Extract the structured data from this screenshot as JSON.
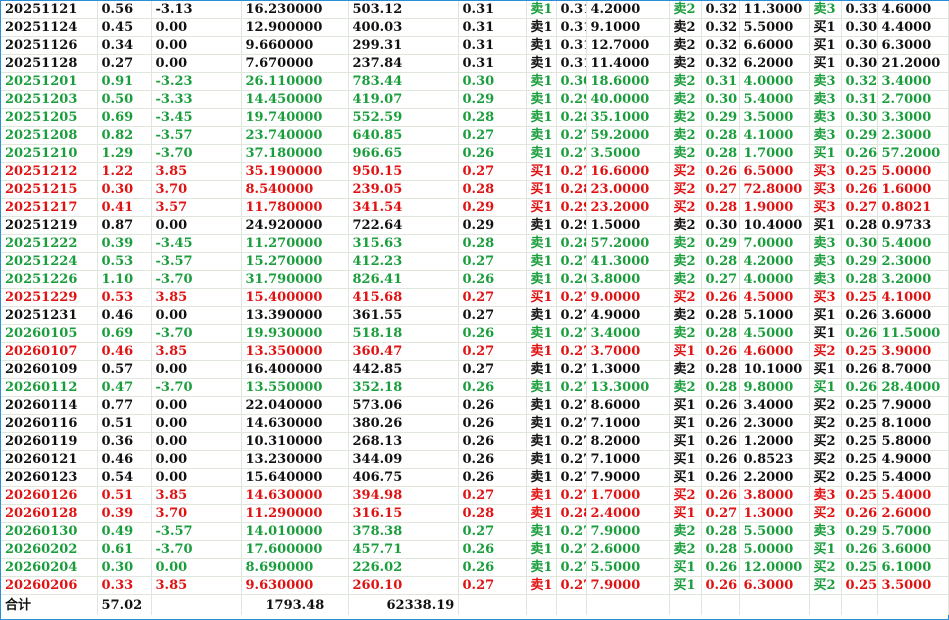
{
  "colors": {
    "black": "#111111",
    "green": "#1a9e3c",
    "red": "#e01212"
  },
  "rows": [
    [
      "20251121",
      "0.56",
      "-3.13",
      "16.230000",
      "503.12",
      "0.31",
      "卖1",
      "0.31",
      "4.2000",
      "卖2",
      "0.32",
      "11.3000",
      "卖3",
      "0.33",
      "4.6000"
    ],
    [
      "20251124",
      "0.45",
      "0.00",
      "12.900000",
      "400.03",
      "0.31",
      "卖1",
      "0.31",
      "9.1000",
      "卖2",
      "0.32",
      "5.5000",
      "买1",
      "0.30",
      "4.4000"
    ],
    [
      "20251126",
      "0.34",
      "0.00",
      "9.660000",
      "299.31",
      "0.31",
      "卖1",
      "0.31",
      "12.7000",
      "卖2",
      "0.32",
      "6.6000",
      "买1",
      "0.30",
      "6.3000"
    ],
    [
      "20251128",
      "0.27",
      "0.00",
      "7.670000",
      "237.84",
      "0.31",
      "卖1",
      "0.31",
      "11.4000",
      "卖2",
      "0.32",
      "6.2000",
      "买1",
      "0.30",
      "21.2000"
    ],
    [
      "20251201",
      "0.91",
      "-3.23",
      "26.110000",
      "783.44",
      "0.30",
      "卖1",
      "0.30",
      "18.6000",
      "卖2",
      "0.31",
      "4.0000",
      "卖3",
      "0.32",
      "3.4000"
    ],
    [
      "20251203",
      "0.50",
      "-3.33",
      "14.450000",
      "419.07",
      "0.29",
      "卖1",
      "0.29",
      "40.0000",
      "卖2",
      "0.30",
      "5.4000",
      "卖3",
      "0.31",
      "2.7000"
    ],
    [
      "20251205",
      "0.69",
      "-3.45",
      "19.740000",
      "552.59",
      "0.28",
      "卖1",
      "0.28",
      "35.1000",
      "卖2",
      "0.29",
      "3.5000",
      "卖3",
      "0.30",
      "3.3000"
    ],
    [
      "20251208",
      "0.82",
      "-3.57",
      "23.740000",
      "640.85",
      "0.27",
      "卖1",
      "0.27",
      "59.2000",
      "卖2",
      "0.28",
      "4.1000",
      "卖3",
      "0.29",
      "2.3000"
    ],
    [
      "20251210",
      "1.29",
      "-3.70",
      "37.180000",
      "966.65",
      "0.26",
      "卖1",
      "0.27",
      "3.5000",
      "卖2",
      "0.28",
      "1.7000",
      "买1",
      "0.26",
      "57.2000"
    ],
    [
      "20251212",
      "1.22",
      "3.85",
      "35.190000",
      "950.15",
      "0.27",
      "买1",
      "0.27",
      "16.6000",
      "买2",
      "0.26",
      "6.5000",
      "买3",
      "0.25",
      "5.0000"
    ],
    [
      "20251215",
      "0.30",
      "3.70",
      "8.540000",
      "239.05",
      "0.28",
      "买1",
      "0.28",
      "23.0000",
      "买2",
      "0.27",
      "72.8000",
      "买3",
      "0.26",
      "1.6000"
    ],
    [
      "20251217",
      "0.41",
      "3.57",
      "11.780000",
      "341.54",
      "0.29",
      "买1",
      "0.29",
      "23.2000",
      "买2",
      "0.28",
      "1.9000",
      "买3",
      "0.27",
      "0.8021"
    ],
    [
      "20251219",
      "0.87",
      "0.00",
      "24.920000",
      "722.64",
      "0.29",
      "卖1",
      "0.29",
      "1.5000",
      "卖2",
      "0.30",
      "10.4000",
      "买1",
      "0.28",
      "0.9733"
    ],
    [
      "20251222",
      "0.39",
      "-3.45",
      "11.270000",
      "315.63",
      "0.28",
      "卖1",
      "0.28",
      "57.2000",
      "卖2",
      "0.29",
      "7.0000",
      "卖3",
      "0.30",
      "5.4000"
    ],
    [
      "20251224",
      "0.53",
      "-3.57",
      "15.270000",
      "412.23",
      "0.27",
      "卖1",
      "0.27",
      "41.3000",
      "卖2",
      "0.28",
      "4.2000",
      "卖3",
      "0.29",
      "2.3000"
    ],
    [
      "20251226",
      "1.10",
      "-3.70",
      "31.790000",
      "826.41",
      "0.26",
      "卖1",
      "0.26",
      "3.8000",
      "卖2",
      "0.27",
      "4.0000",
      "卖3",
      "0.28",
      "3.2000"
    ],
    [
      "20251229",
      "0.53",
      "3.85",
      "15.400000",
      "415.68",
      "0.27",
      "买1",
      "0.27",
      "9.0000",
      "买2",
      "0.26",
      "4.5000",
      "买3",
      "0.25",
      "4.1000"
    ],
    [
      "20251231",
      "0.46",
      "0.00",
      "13.390000",
      "361.55",
      "0.27",
      "卖1",
      "0.27",
      "4.9000",
      "卖2",
      "0.28",
      "5.1000",
      "买1",
      "0.26",
      "3.6000"
    ],
    [
      "20260105",
      "0.69",
      "-3.70",
      "19.930000",
      "518.18",
      "0.26",
      "卖1",
      "0.27",
      "3.4000",
      "卖2",
      "0.28",
      "4.5000",
      "买1",
      "0.26",
      "11.5000"
    ],
    [
      "20260107",
      "0.46",
      "3.85",
      "13.350000",
      "360.47",
      "0.27",
      "卖1",
      "0.27",
      "3.7000",
      "买1",
      "0.26",
      "4.6000",
      "买2",
      "0.25",
      "3.9000"
    ],
    [
      "20260109",
      "0.57",
      "0.00",
      "16.400000",
      "442.85",
      "0.27",
      "卖1",
      "0.27",
      "1.3000",
      "卖2",
      "0.28",
      "10.1000",
      "买1",
      "0.26",
      "8.7000"
    ],
    [
      "20260112",
      "0.47",
      "-3.70",
      "13.550000",
      "352.18",
      "0.26",
      "卖1",
      "0.27",
      "13.3000",
      "卖2",
      "0.28",
      "9.8000",
      "买1",
      "0.26",
      "28.4000"
    ],
    [
      "20260114",
      "0.77",
      "0.00",
      "22.040000",
      "573.06",
      "0.26",
      "卖1",
      "0.27",
      "8.6000",
      "买1",
      "0.26",
      "3.4000",
      "买2",
      "0.25",
      "7.9000"
    ],
    [
      "20260116",
      "0.51",
      "0.00",
      "14.630000",
      "380.26",
      "0.26",
      "卖1",
      "0.27",
      "7.1000",
      "买1",
      "0.26",
      "2.3000",
      "买2",
      "0.25",
      "8.1000"
    ],
    [
      "20260119",
      "0.36",
      "0.00",
      "10.310000",
      "268.13",
      "0.26",
      "卖1",
      "0.27",
      "8.2000",
      "买1",
      "0.26",
      "1.2000",
      "买2",
      "0.25",
      "5.8000"
    ],
    [
      "20260121",
      "0.46",
      "0.00",
      "13.230000",
      "344.09",
      "0.26",
      "卖1",
      "0.27",
      "7.1000",
      "买1",
      "0.26",
      "0.8523",
      "买2",
      "0.25",
      "4.9000"
    ],
    [
      "20260123",
      "0.54",
      "0.00",
      "15.640000",
      "406.75",
      "0.26",
      "卖1",
      "0.27",
      "7.9000",
      "买1",
      "0.26",
      "2.2000",
      "买2",
      "0.25",
      "5.4000"
    ],
    [
      "20260126",
      "0.51",
      "3.85",
      "14.630000",
      "394.98",
      "0.27",
      "卖1",
      "0.27",
      "1.7000",
      "买2",
      "0.26",
      "3.8000",
      "卖3",
      "0.25",
      "5.4000"
    ],
    [
      "20260128",
      "0.39",
      "3.70",
      "11.290000",
      "316.15",
      "0.28",
      "卖1",
      "0.28",
      "2.4000",
      "买1",
      "0.27",
      "1.3000",
      "买2",
      "0.26",
      "2.6000"
    ],
    [
      "20260130",
      "0.49",
      "-3.57",
      "14.010000",
      "378.38",
      "0.27",
      "卖1",
      "0.27",
      "7.9000",
      "卖2",
      "0.28",
      "5.5000",
      "卖3",
      "0.29",
      "5.7000"
    ],
    [
      "20260202",
      "0.61",
      "-3.70",
      "17.600000",
      "457.71",
      "0.26",
      "卖1",
      "0.27",
      "2.6000",
      "卖2",
      "0.28",
      "5.0000",
      "买1",
      "0.26",
      "3.6000"
    ],
    [
      "20260204",
      "0.30",
      "0.00",
      "8.690000",
      "226.02",
      "0.26",
      "卖1",
      "0.27",
      "5.5000",
      "买1",
      "0.26",
      "12.0000",
      "买2",
      "0.25",
      "6.1000"
    ],
    [
      "20260206",
      "0.33",
      "3.85",
      "9.630000",
      "260.10",
      "0.27",
      "卖1",
      "0.27",
      "7.9000",
      "买1",
      "0.26",
      "6.3000",
      "买2",
      "0.25",
      "3.5000"
    ]
  ],
  "row_colors": [
    "black",
    "black",
    "black",
    "black",
    "green",
    "green",
    "green",
    "green",
    "green",
    "red",
    "red",
    "red",
    "black",
    "green",
    "green",
    "green",
    "red",
    "black",
    "green",
    "red",
    "black",
    "green",
    "black",
    "black",
    "black",
    "black",
    "black",
    "red",
    "red",
    "green",
    "green",
    "green",
    "red"
  ],
  "tag_colors": [
    [
      "green",
      "green",
      "green"
    ],
    [
      "black",
      "black",
      "black"
    ],
    [
      "black",
      "black",
      "black"
    ],
    [
      "black",
      "black",
      "black"
    ],
    [
      "green",
      "green",
      "green"
    ],
    [
      "green",
      "green",
      "green"
    ],
    [
      "green",
      "green",
      "green"
    ],
    [
      "green",
      "green",
      "green"
    ],
    [
      "green",
      "green",
      "green"
    ],
    [
      "red",
      "red",
      "red"
    ],
    [
      "red",
      "red",
      "red"
    ],
    [
      "red",
      "red",
      "red"
    ],
    [
      "black",
      "black",
      "black"
    ],
    [
      "green",
      "green",
      "green"
    ],
    [
      "green",
      "green",
      "green"
    ],
    [
      "green",
      "green",
      "green"
    ],
    [
      "red",
      "red",
      "red"
    ],
    [
      "black",
      "black",
      "black"
    ],
    [
      "green",
      "green",
      "black"
    ],
    [
      "red",
      "red",
      "red"
    ],
    [
      "black",
      "black",
      "black"
    ],
    [
      "green",
      "green",
      "green"
    ],
    [
      "black",
      "black",
      "black"
    ],
    [
      "black",
      "black",
      "black"
    ],
    [
      "black",
      "black",
      "black"
    ],
    [
      "black",
      "black",
      "black"
    ],
    [
      "black",
      "black",
      "black"
    ],
    [
      "red",
      "red",
      "red"
    ],
    [
      "red",
      "red",
      "red"
    ],
    [
      "green",
      "green",
      "green"
    ],
    [
      "green",
      "green",
      "green"
    ],
    [
      "green",
      "green",
      "green"
    ],
    [
      "red",
      "green",
      "green"
    ]
  ],
  "total": {
    "label": "合计",
    "volume": "57.02",
    "amount": "1793.48",
    "value": "62338.19"
  }
}
